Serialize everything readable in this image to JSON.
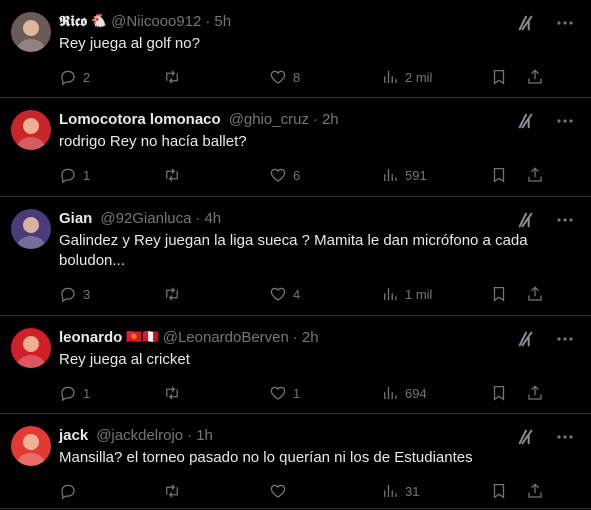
{
  "tweets": [
    {
      "name": "𝕽𝖎𝖈𝖔",
      "badge": "🐔",
      "handle": "@Niicooo912",
      "time": "5h",
      "text": "Rey juega al golf no?",
      "replies": "2",
      "retweets": "",
      "likes": "8",
      "views": "2 mil",
      "avatar_color": "#6b5a58"
    },
    {
      "name": "Lomocotora lomonaco",
      "badge": "",
      "handle": "@ghio_cruz",
      "time": "2h",
      "text": "rodrigo Rey no hacía ballet?",
      "replies": "1",
      "retweets": "",
      "likes": "6",
      "views": "591",
      "avatar_color": "#c8262c"
    },
    {
      "name": "Gian",
      "badge": "",
      "handle": "@92Gianluca",
      "time": "4h",
      "text": "Galindez y Rey juegan la liga sueca ? Mamita le dan micrófono a cada boludon...",
      "replies": "3",
      "retweets": "",
      "likes": "4",
      "views": "1 mil",
      "avatar_color": "#4a3c7a"
    },
    {
      "name": "leonardo",
      "badge": "🇰🇬🇵🇪",
      "handle": "@LeonardoBerven",
      "time": "2h",
      "text": "Rey juega al cricket",
      "replies": "1",
      "retweets": "",
      "likes": "1",
      "views": "694",
      "avatar_color": "#d11f2a"
    },
    {
      "name": "jack",
      "badge": "",
      "handle": "@jackdelrojo",
      "time": "1h",
      "text": "Mansilla? el torneo pasado no lo querían ni los de Estudiantes",
      "replies": "",
      "retweets": "",
      "likes": "",
      "views": "31",
      "avatar_color": "#e23b35"
    }
  ],
  "icons": {
    "reply": "reply-icon",
    "retweet": "retweet-icon",
    "like": "heart-icon",
    "views": "views-icon",
    "bookmark": "bookmark-icon",
    "share": "share-icon",
    "grok": "grok-icon",
    "more": "more-icon"
  }
}
